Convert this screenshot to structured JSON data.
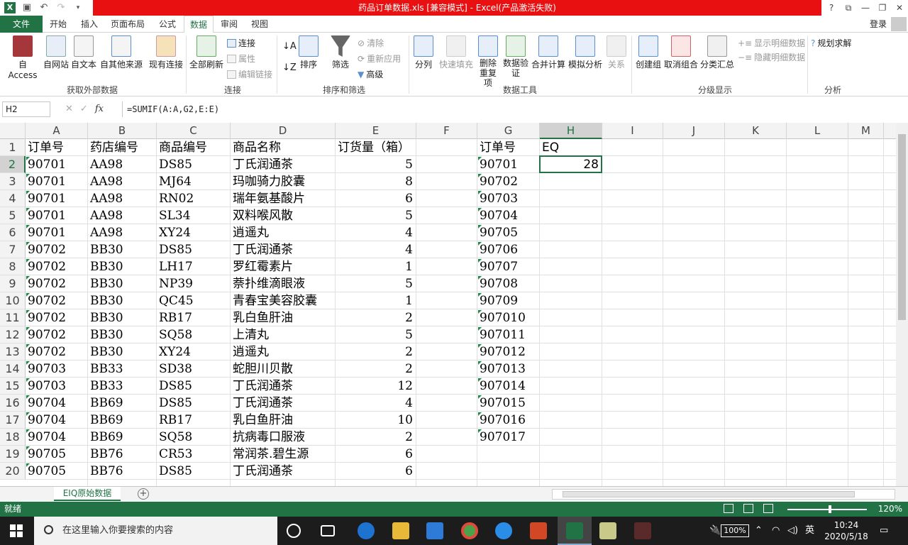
{
  "window": {
    "title": "药品订单数据.xls  [兼容模式] - Excel(产品激活失败)"
  },
  "title_buttons": [
    "?",
    "⧉",
    "—",
    "❐",
    "✕"
  ],
  "tabs": {
    "file": "文件",
    "items": [
      "开始",
      "插入",
      "页面布局",
      "公式",
      "数据",
      "审阅",
      "视图"
    ],
    "active": "数据",
    "login": "登录"
  },
  "ribbon": {
    "get_external": {
      "buttons": [
        "自 Access",
        "自网站",
        "自文本",
        "自其他来源"
      ],
      "label": "获取外部数据"
    },
    "existing_conn": "现有连接",
    "refresh_all": "全部刷新",
    "connections": {
      "items": [
        "连接",
        "属性",
        "编辑链接"
      ],
      "label": "连接"
    },
    "sort_filter": {
      "sort": "排序",
      "filter": "筛选",
      "clear": "清除",
      "reapply": "重新应用",
      "advanced": "高级",
      "label": "排序和筛选"
    },
    "data_tools": {
      "split": "分列",
      "flash_fill": "快速填充",
      "remove_dup": "删除重复项",
      "validation": "数据验证",
      "consolidate": "合并计算",
      "whatif": "模拟分析",
      "relations": "关系",
      "label": "数据工具"
    },
    "outline": {
      "group": "创建组",
      "ungroup": "取消组合",
      "subtotal": "分类汇总",
      "show_detail": "显示明细数据",
      "hide_detail": "隐藏明细数据",
      "label": "分级显示"
    },
    "analysis": {
      "solver": "规划求解",
      "label": "分析"
    }
  },
  "formula_bar": {
    "name_box": "H2",
    "fx": "fx",
    "formula": "=SUMIF(A:A,G2,E:E)"
  },
  "columns": [
    "A",
    "B",
    "C",
    "D",
    "E",
    "F",
    "G",
    "H",
    "I",
    "J",
    "K",
    "L",
    "M"
  ],
  "selected_column": "H",
  "selected_row": "2",
  "rows": [
    {
      "n": "1",
      "A": "订单号",
      "B": "药店编号",
      "C": "商品编号",
      "D": "商品名称",
      "E": "订货量（箱）",
      "G": "订单号",
      "H": "EQ"
    },
    {
      "n": "2",
      "A": "90701",
      "B": "AA98",
      "C": "DS85",
      "D": "丁氏润通茶",
      "E": "5",
      "G": "90701",
      "H": "28"
    },
    {
      "n": "3",
      "A": "90701",
      "B": "AA98",
      "C": "MJ64",
      "D": "玛咖骑力胶囊",
      "E": "8",
      "G": "90702"
    },
    {
      "n": "4",
      "A": "90701",
      "B": "AA98",
      "C": "RN02",
      "D": "瑞年氨基酸片",
      "E": "6",
      "G": "90703"
    },
    {
      "n": "5",
      "A": "90701",
      "B": "AA98",
      "C": "SL34",
      "D": "双料喉风散",
      "E": "5",
      "G": "90704"
    },
    {
      "n": "6",
      "A": "90701",
      "B": "AA98",
      "C": "XY24",
      "D": "逍遥丸",
      "E": "4",
      "G": "90705"
    },
    {
      "n": "7",
      "A": "90702",
      "B": "BB30",
      "C": "DS85",
      "D": "丁氏润通茶",
      "E": "4",
      "G": "90706"
    },
    {
      "n": "8",
      "A": "90702",
      "B": "BB30",
      "C": "LH17",
      "D": "罗红霉素片",
      "E": "1",
      "G": "90707"
    },
    {
      "n": "9",
      "A": "90702",
      "B": "BB30",
      "C": "NP39",
      "D": "萘扑维滴眼液",
      "E": "5",
      "G": "90708"
    },
    {
      "n": "10",
      "A": "90702",
      "B": "BB30",
      "C": "QC45",
      "D": "青春宝美容胶囊",
      "E": "1",
      "G": "90709"
    },
    {
      "n": "11",
      "A": "90702",
      "B": "BB30",
      "C": "RB17",
      "D": "乳白鱼肝油",
      "E": "2",
      "G": "907010"
    },
    {
      "n": "12",
      "A": "90702",
      "B": "BB30",
      "C": "SQ58",
      "D": "上清丸",
      "E": "5",
      "G": "907011"
    },
    {
      "n": "13",
      "A": "90702",
      "B": "BB30",
      "C": "XY24",
      "D": "逍遥丸",
      "E": "2",
      "G": "907012"
    },
    {
      "n": "14",
      "A": "90703",
      "B": "BB33",
      "C": "SD38",
      "D": "蛇胆川贝散",
      "E": "2",
      "G": "907013"
    },
    {
      "n": "15",
      "A": "90703",
      "B": "BB33",
      "C": "DS85",
      "D": "丁氏润通茶",
      "E": "12",
      "G": "907014"
    },
    {
      "n": "16",
      "A": "90704",
      "B": "BB69",
      "C": "DS85",
      "D": "丁氏润通茶",
      "E": "4",
      "G": "907015"
    },
    {
      "n": "17",
      "A": "90704",
      "B": "BB69",
      "C": "RB17",
      "D": "乳白鱼肝油",
      "E": "10",
      "G": "907016"
    },
    {
      "n": "18",
      "A": "90704",
      "B": "BB69",
      "C": "SQ58",
      "D": "抗病毒口服液",
      "E": "2",
      "G": "907017"
    },
    {
      "n": "19",
      "A": "90705",
      "B": "BB76",
      "C": "CR53",
      "D": "常润茶.碧生源",
      "E": "6"
    },
    {
      "n": "20",
      "A": "90705",
      "B": "BB76",
      "C": "DS85",
      "D": "丁氏润通茶",
      "E": "6"
    }
  ],
  "sheet": {
    "tab": "EIQ原始数据",
    "add": "+"
  },
  "status": {
    "text": "就绪",
    "zoom": "120%"
  },
  "taskbar": {
    "search_placeholder": "在这里输入你要搜索的内容",
    "battery": "100%",
    "ime": "英",
    "time": "10:24",
    "date": "2020/5/18"
  }
}
